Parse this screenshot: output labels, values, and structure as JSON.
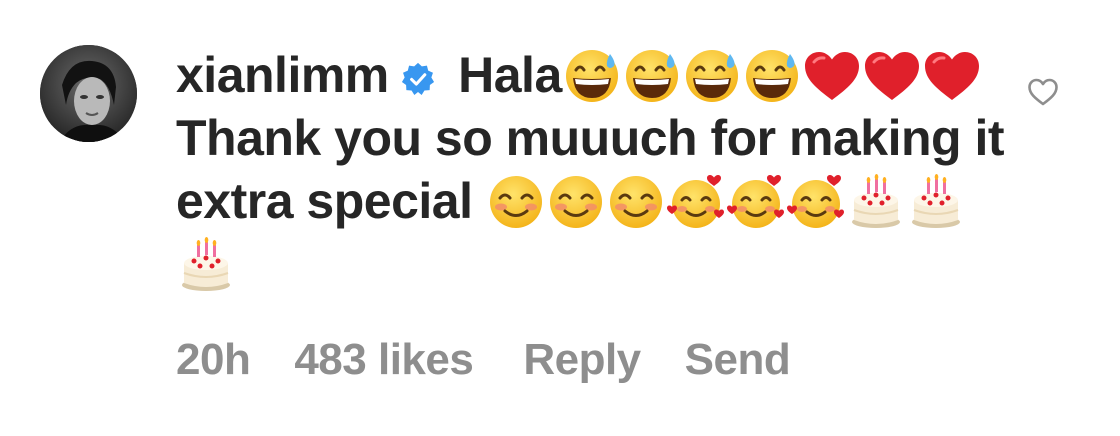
{
  "comment": {
    "username": "xianlimm",
    "verified": true,
    "segments": [
      {
        "type": "text",
        "value": " Hala"
      },
      {
        "type": "emoji",
        "name": "grinning-sweat-emoji"
      },
      {
        "type": "emoji",
        "name": "grinning-sweat-emoji"
      },
      {
        "type": "emoji",
        "name": "grinning-sweat-emoji"
      },
      {
        "type": "emoji",
        "name": "grinning-sweat-emoji"
      },
      {
        "type": "emoji",
        "name": "red-heart-emoji"
      },
      {
        "type": "emoji",
        "name": "red-heart-emoji"
      },
      {
        "type": "emoji",
        "name": "red-heart-emoji"
      },
      {
        "type": "text",
        "value": " Thank you so muuuch for making it extra special "
      },
      {
        "type": "emoji",
        "name": "smiling-blush-emoji"
      },
      {
        "type": "emoji",
        "name": "smiling-blush-emoji"
      },
      {
        "type": "emoji",
        "name": "smiling-blush-emoji"
      },
      {
        "type": "emoji",
        "name": "smiling-hearts-emoji"
      },
      {
        "type": "emoji",
        "name": "smiling-hearts-emoji"
      },
      {
        "type": "emoji",
        "name": "smiling-hearts-emoji"
      },
      {
        "type": "emoji",
        "name": "birthday-cake-emoji"
      },
      {
        "type": "emoji",
        "name": "birthday-cake-emoji"
      },
      {
        "type": "emoji",
        "name": "birthday-cake-emoji"
      }
    ]
  },
  "meta": {
    "time": "20h",
    "likes": "483 likes",
    "reply": "Reply",
    "send": "Send"
  },
  "icons": {
    "like": "heart-outline-icon",
    "verified": "verified-badge-icon"
  },
  "colors": {
    "text": "#262626",
    "meta": "#8e8e8e",
    "verified": "#3897f0",
    "heart_outline": "#8e8e8e"
  }
}
